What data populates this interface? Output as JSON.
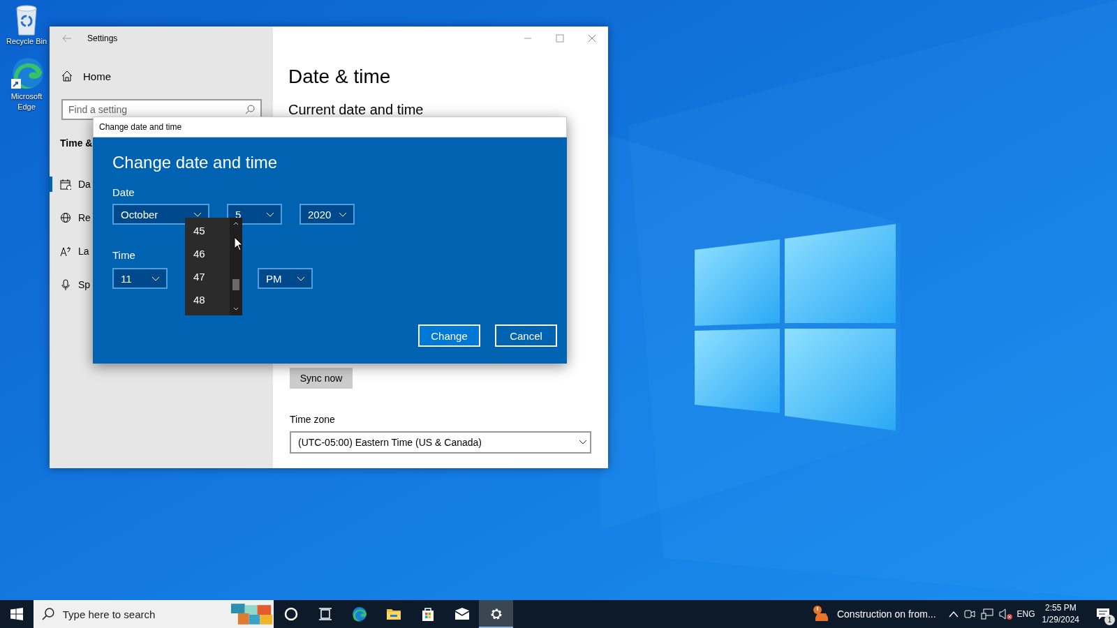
{
  "desktop_icons": [
    {
      "label": "Recycle Bin",
      "kind": "recycle"
    },
    {
      "label": "Microsoft Edge",
      "kind": "edge"
    }
  ],
  "settings_window": {
    "title": "Settings",
    "home": "Home",
    "search_placeholder": "Find a setting",
    "section": "Time &",
    "nav_items": [
      {
        "label": "Da",
        "kind": "calendar",
        "selected": true
      },
      {
        "label": "Re",
        "kind": "globe",
        "selected": false
      },
      {
        "label": "La",
        "kind": "language",
        "selected": false
      },
      {
        "label": "Sp",
        "kind": "mic",
        "selected": false
      }
    ],
    "heading": "Date & time",
    "subheading": "Current date and time",
    "sync_button": "Sync now",
    "time_zone_label": "Time zone",
    "time_zone": "(UTC-05:00) Eastern Time (US & Canada)"
  },
  "dialog": {
    "title": "Change date and time",
    "heading": "Change date and time",
    "date_label": "Date",
    "date_fields": [
      "October",
      "5",
      "2020"
    ],
    "time_label": "Time",
    "hour": "11",
    "period": "PM",
    "minute_options": [
      "45",
      "46",
      "47",
      "48"
    ],
    "buttons": [
      {
        "label": "Change",
        "kind": "primary"
      },
      {
        "label": "Cancel",
        "kind": "secondary"
      }
    ]
  },
  "taskbar": {
    "search_placeholder": "Type here to search",
    "apps": [
      {
        "kind": "cortana",
        "selected": false
      },
      {
        "kind": "task-view",
        "selected": false
      },
      {
        "kind": "edge",
        "selected": false
      },
      {
        "kind": "explorer",
        "selected": false
      },
      {
        "kind": "store",
        "selected": false
      },
      {
        "kind": "mail",
        "selected": false
      },
      {
        "kind": "settings",
        "selected": true
      }
    ],
    "news": "Construction on from...",
    "language": "ENG",
    "time": "2:55 PM",
    "date": "1/29/2024",
    "notification_count": "1"
  }
}
